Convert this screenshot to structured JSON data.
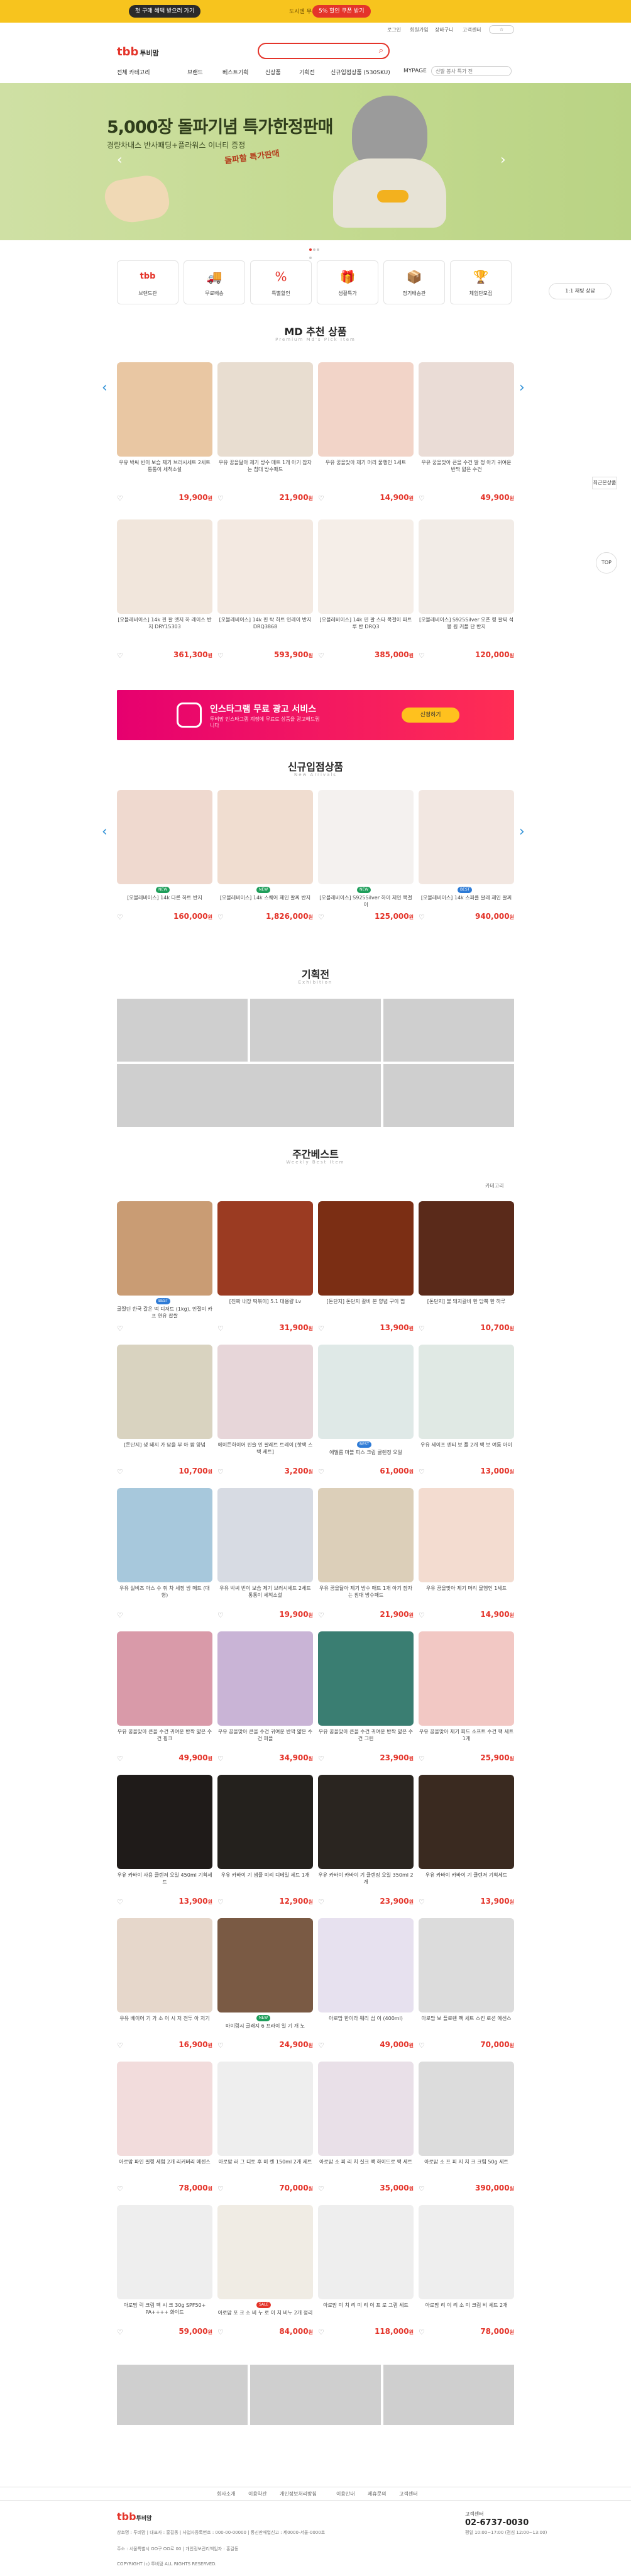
{
  "topbar": {
    "promo_left": "첫 구매 혜택 받으러 가기",
    "promo_mid": "도시엔 무료 이벤트",
    "promo_right": "5% 할인 쿠폰 받기"
  },
  "util_links": [
    "로그인",
    "회원가입",
    "장바구니",
    "고객센터"
  ],
  "header": {
    "logo": "tbb",
    "logo_sub": "투비맘"
  },
  "nav": [
    "전체 카테고리",
    "브랜드",
    "베스트기획",
    "신상품",
    "기획전",
    "신규입점상품 (530SKU)",
    "MYPAGE"
  ],
  "search_hint": "신발 봉사 특가 전",
  "hero": {
    "title": "5,000장 돌파기념 특가한정판매",
    "sub": "경량차내스 반사패딩+플라워스 이너티 증정",
    "badge": "돌파할 특가판매"
  },
  "quick": [
    {
      "label": "브랜드관",
      "icon": "tbb-icon"
    },
    {
      "label": "무료배송",
      "icon": "truck-icon"
    },
    {
      "label": "특별할인",
      "icon": "sale-icon"
    },
    {
      "label": "생활특가",
      "icon": "gift-icon"
    },
    {
      "label": "정기배송관",
      "icon": "box-icon"
    },
    {
      "label": "체험단모집",
      "icon": "trophy-icon"
    }
  ],
  "side": {
    "chat": "1:1 채팅 상담",
    "top": "TOP",
    "recent": "최근본상품"
  },
  "md": {
    "title": "MD 추천 상품",
    "sub": "Premium Md's Pick Item",
    "products": [
      {
        "name": "우유 박씨 빈이 보습 제기 브러시세트 2세트 통통이 세척소설",
        "price": "19,900",
        "color": "#e9c7a3"
      },
      {
        "name": "우유 꿈을닮아 제기 방수 매트 1개 아기 잠자는 침대 방수패드",
        "price": "21,900",
        "color": "#e8ddd0"
      },
      {
        "name": "우유 꿈을맞아 제기 머리 물행인 1세트",
        "price": "14,900",
        "color": "#f2d4c8"
      },
      {
        "name": "우유 꿈을맞아 큰을 수건 발 정 아기 귀여운 반짝 얇은 수건",
        "price": "49,900",
        "color": "#eadcd6"
      },
      {
        "name": "[오블레비이스] 14k 핀 팔 엣지 하 레이스 반지 DRY15303",
        "price": "361,300",
        "color": "#f1e6dc"
      },
      {
        "name": "[오블레비이스] 14k 핀 탁 하트 인레이 반지 DRQ3868",
        "price": "593,900",
        "color": "#f3e9e1"
      },
      {
        "name": "[오블레비이스] 14k 핀 팔 스타 목걸이 파트 루 반 DRQ3",
        "price": "385,000",
        "color": "#f5eee8"
      },
      {
        "name": "[오블레비이스] S925Silver 오픈 링 팔찌 석 봉 원 커플 단 반지",
        "price": "120,000",
        "color": "#f2ece7"
      }
    ]
  },
  "insta": {
    "title": "인스타그램 무료 광고 서비스",
    "desc": "투비맘 인스타그램 계정에 무료로 상품을 광고해드립니다",
    "button": "신청하기"
  },
  "newin": {
    "title": "신규입점상품",
    "sub": "New Arrivals",
    "products": [
      {
        "name": "[오블레비이스] 14k 다른 하트 반지",
        "price": "160,000",
        "color": "#efd9cf",
        "tag": "NEW"
      },
      {
        "name": "[오블레비이스] 14k 스퀘어 체인 팔찌 반지",
        "price": "1,826,000",
        "color": "#f0ddd0",
        "tag": "NEW"
      },
      {
        "name": "[오블레비이스] S925Silver 하이 체인 목걸이",
        "price": "125,000",
        "color": "#f4f1ef",
        "tag": "NEW"
      },
      {
        "name": "[오블레비이스] 14k 스파클 팔레 체인 팔찌",
        "price": "940,000",
        "color": "#f2e7e1",
        "tag": "BEST"
      }
    ]
  },
  "events": {
    "title": "기획전",
    "sub": "Exhibition"
  },
  "weekly": {
    "title": "주간베스트",
    "sub": "Weekly Best Item",
    "more": "카테고리",
    "products": [
      {
        "name": "굴딸딘 한국 갈은 떡 디저트 (1kg), 인절미 카프 연유 찹쌀",
        "price": "",
        "color": "#c99c74",
        "tag": "BEST"
      },
      {
        "name": "[진짜 내장 떡볶이] 5.1 대용량 Lv",
        "price": "31,900",
        "color": "#9b3b22",
        "tag": ""
      },
      {
        "name": "[돈단지] 돈단지 갈비 본 양념 구이 찜",
        "price": "13,900",
        "color": "#7b2e14",
        "tag": ""
      },
      {
        "name": "[돈단지] 불 돼지갈비 한 담뿍 한 하루",
        "price": "10,700",
        "color": "#5a2a1a",
        "tag": ""
      },
      {
        "name": "[돈단지] 생 돼지 가 담을 부 아 쌈 양념",
        "price": "10,700",
        "color": "#d9d3c0",
        "tag": ""
      },
      {
        "name": "에이든하이어 핀슬 인 팔레트 트레이 [핫팩 스택 세트]",
        "price": "3,200",
        "color": "#e7d6d9",
        "tag": ""
      },
      {
        "name": "애벌룸 마블 피스 크림 클렌징 오일",
        "price": "61,000",
        "color": "#dfe9e7",
        "tag": "BEST"
      },
      {
        "name": "우유 세이프 엔티 보 플 2개 팩 보 여름 아이",
        "price": "13,000",
        "color": "#e0e9e4",
        "tag": ""
      },
      {
        "name": "우유 실비즈 아스 수 쥐 차 세정 방 매트 (대형)",
        "price": "",
        "color": "#a7c8dc",
        "tag": ""
      },
      {
        "name": "우유 박씨 빈이 보습 제기 브러시세트 2세트 통통이 세척소설",
        "price": "19,900",
        "color": "#d7dbe3",
        "tag": ""
      },
      {
        "name": "우유 꿈을닮아 제기 방수 매트 1개 아기 잠자는 침대 방수패드",
        "price": "21,900",
        "color": "#dccfb9",
        "tag": ""
      },
      {
        "name": "우유 꿈을맞아 제기 머리 물행인 1세트",
        "price": "14,900",
        "color": "#f3dcd0",
        "tag": ""
      },
      {
        "name": "우유 꿈을맞아 큰을 수건 귀여운 반짝 얇은 수건 핑크",
        "price": "49,900",
        "color": "#d99aa9",
        "tag": ""
      },
      {
        "name": "우유 꿈을맞아 큰을 수건 귀여운 반짝 얇은 수건 퍼플",
        "price": "34,900",
        "color": "#c9b4d6",
        "tag": ""
      },
      {
        "name": "우유 꿈을맞아 큰을 수건 귀여운 반짝 얇은 수건 그린",
        "price": "23,900",
        "color": "#3a7e72",
        "tag": ""
      },
      {
        "name": "우유 꿈을맞아 제기 피드 소프트 수건 팩 세트 1개",
        "price": "25,900",
        "color": "#f2c8c4",
        "tag": ""
      },
      {
        "name": "우유 카바이 사용 클렌저 오일 450ml 기획세트",
        "price": "13,900",
        "color": "#1f1b19",
        "tag": ""
      },
      {
        "name": "우유 카바이 기 샘플 미리 디테일 세트 1개",
        "price": "12,900",
        "color": "#24211d",
        "tag": ""
      },
      {
        "name": "우유 카바이 카바이 기 클렌징 오일 350ml 2개",
        "price": "23,900",
        "color": "#2a2520",
        "tag": ""
      },
      {
        "name": "우유 카바이 카바이 기 클렌저 기획세트",
        "price": "13,900",
        "color": "#3a2a20",
        "tag": ""
      },
      {
        "name": "우유 베이어 기 가 소 이 시 저 전투 아 저기",
        "price": "16,900",
        "color": "#e6d7cb",
        "tag": ""
      },
      {
        "name": "마이링시 글래지 6 프라이 일 기 개 노",
        "price": "24,900",
        "color": "#7a5a44",
        "tag": "NEW"
      },
      {
        "name": "아로맘 한이라 웨리 섬 이 (400ml)",
        "price": "49,000",
        "color": "#e7e1ef",
        "tag": ""
      },
      {
        "name": "아로맘 보 플로렌 팩 세트 스킨 로션 에센스",
        "price": "70,000",
        "color": "#dcdcdc",
        "tag": ""
      },
      {
        "name": "아로맘 파인 필링 세럼 2개 리커버리 에센스",
        "price": "78,000",
        "color": "#f2dcdc",
        "tag": ""
      },
      {
        "name": "아로맘 러 그 디토 후 미 렌 150ml 2개 세트",
        "price": "70,000",
        "color": "#eeeeee",
        "tag": ""
      },
      {
        "name": "아로맘 소 피 리 치 실크 팩 하이드로 팩 세트",
        "price": "35,000",
        "color": "#e9e0e8",
        "tag": ""
      },
      {
        "name": "아로맘 소 프 피 지 치 크 크림 50g 세트",
        "price": "390,000",
        "color": "#dcdcdc",
        "tag": ""
      },
      {
        "name": "아로맘 럭 크림 팩 시 크 30g SPF50+ PA++++ 화이트",
        "price": "59,000",
        "color": "#eeeeee",
        "tag": ""
      },
      {
        "name": "아로맘 포 크 소 비 누 로 이 치 비누 2개 정리",
        "price": "84,000",
        "color": "#f0ece4",
        "tag": "SALE"
      },
      {
        "name": "아로맘 미 치 리 미 리 이 프 로 그램 세트",
        "price": "118,000",
        "color": "#eeeeee",
        "tag": ""
      },
      {
        "name": "아로맘 리 이 리 소 미 크림 비 세트 2개",
        "price": "78,000",
        "color": "#eeeeee",
        "tag": ""
      }
    ]
  },
  "footer": {
    "links": [
      "회사소개",
      "이용약관",
      "개인정보처리방침",
      "이용안내",
      "제휴문의",
      "고객센터"
    ],
    "logo": "tbb",
    "logo_sub": "투비맘",
    "info": "상호명 : 투비맘 | 대표자 : 홍길동 | 사업자등록번호 : 000-00-00000 | 통신판매업신고 : 제0000-서울-0000호",
    "address": "주소 : 서울특별시 OO구 OO로 00 | 개인정보관리책임자 : 홍길동",
    "copyright": "COPYRIGHT (c) 투비맘 ALL RIGHTS RESERVED.",
    "cs_label": "고객센터",
    "phone": "02-6737-0030",
    "cs_hours": "평일 10:00~17:00 (점심 12:00~13:00)"
  },
  "currency": "원"
}
